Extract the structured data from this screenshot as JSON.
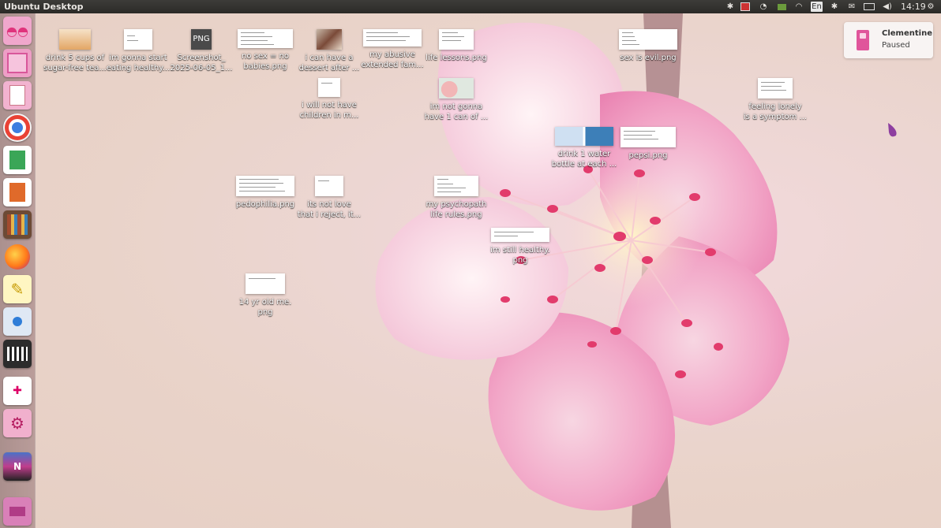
{
  "panel": {
    "title": "Ubuntu Desktop",
    "clock": "14:19",
    "keyboard": "En"
  },
  "tray_icons": [
    "bluetooth-icon",
    "screen-record-icon",
    "network-wifi-icon",
    "battery-app-icon",
    "wifi-icon",
    "keyboard-layout-icon",
    "bluetooth-off-icon",
    "mail-icon",
    "battery-icon",
    "volume-icon",
    "clock",
    "settings-gear-icon"
  ],
  "launcher": {
    "items": [
      "glasses-app-icon",
      "pink-archive-icon",
      "text-editor-pink-icon",
      "chrome-icon",
      "spreadsheet-icon",
      "presentation-icon",
      "library-icon",
      "firefox-icon",
      "notes-icon",
      "disk-utility-icon",
      "video-editor-icon",
      "games-icon",
      "settings-pink-icon",
      "stacked-apps-icon",
      "trash-icon"
    ]
  },
  "notification": {
    "title": "Clementine",
    "body": "Paused",
    "icon": "clementine-icon"
  },
  "desktop_icons": [
    {
      "label": "drink 5 cups of\nsugar-free tea..."
    },
    {
      "label": "im gonna start\neating healthy..."
    },
    {
      "label": "Screenshot_\n2025-06-05_1..."
    },
    {
      "label": "no sex = no\nbabies.png"
    },
    {
      "label": "i can have a\ndessert after ..."
    },
    {
      "label": "my abusive\nextended fam..."
    },
    {
      "label": "life lessons.png"
    },
    {
      "label": "sex is evil.png"
    },
    {
      "label": "i will not have\nchildren in m..."
    },
    {
      "label": "im not gonna\nhave 1 can of ..."
    },
    {
      "label": "feeling lonely\nis a symptom ..."
    },
    {
      "label": "drink 1 water\nbottle at each ..."
    },
    {
      "label": "pepsi.png"
    },
    {
      "label": "pedophilia.png"
    },
    {
      "label": "its not love\nthat i reject, it..."
    },
    {
      "label": "my psychopath\nlife rules.png"
    },
    {
      "label": "im still healthy.\npng"
    },
    {
      "label": "14 yr old me.\npng"
    }
  ],
  "thumb_texts": {
    "png_badge": "PNG"
  },
  "colors": {
    "panel": "#2f2e2b",
    "petal": "#f4b9d2",
    "petal_dark": "#e85b96",
    "stamen": "#e23b6c"
  }
}
